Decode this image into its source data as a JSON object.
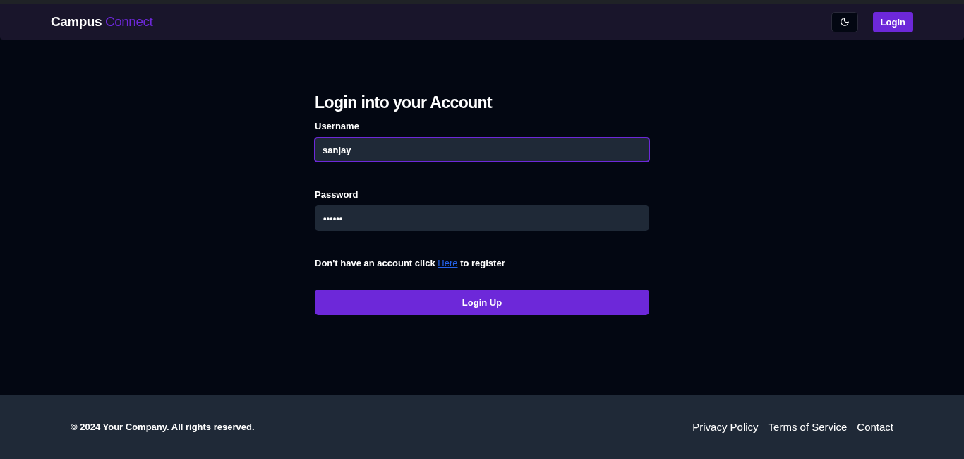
{
  "header": {
    "brand_first": "Campus",
    "brand_second": "Connect",
    "login_button": "Login"
  },
  "form": {
    "title": "Login into your Account",
    "fields": [
      {
        "label": "Username",
        "value": "sanjay",
        "focused": true
      },
      {
        "label": "Password",
        "value": "••••••",
        "focused": false
      }
    ],
    "register_prompt": {
      "before": "Don't have an account click",
      "link": "Here",
      "after": "to register"
    },
    "submit": "Login Up"
  },
  "footer": {
    "copyright": "© 2024 Your Company. All rights reserved.",
    "links": [
      "Privacy Policy",
      "Terms of Service",
      "Contact"
    ]
  }
}
